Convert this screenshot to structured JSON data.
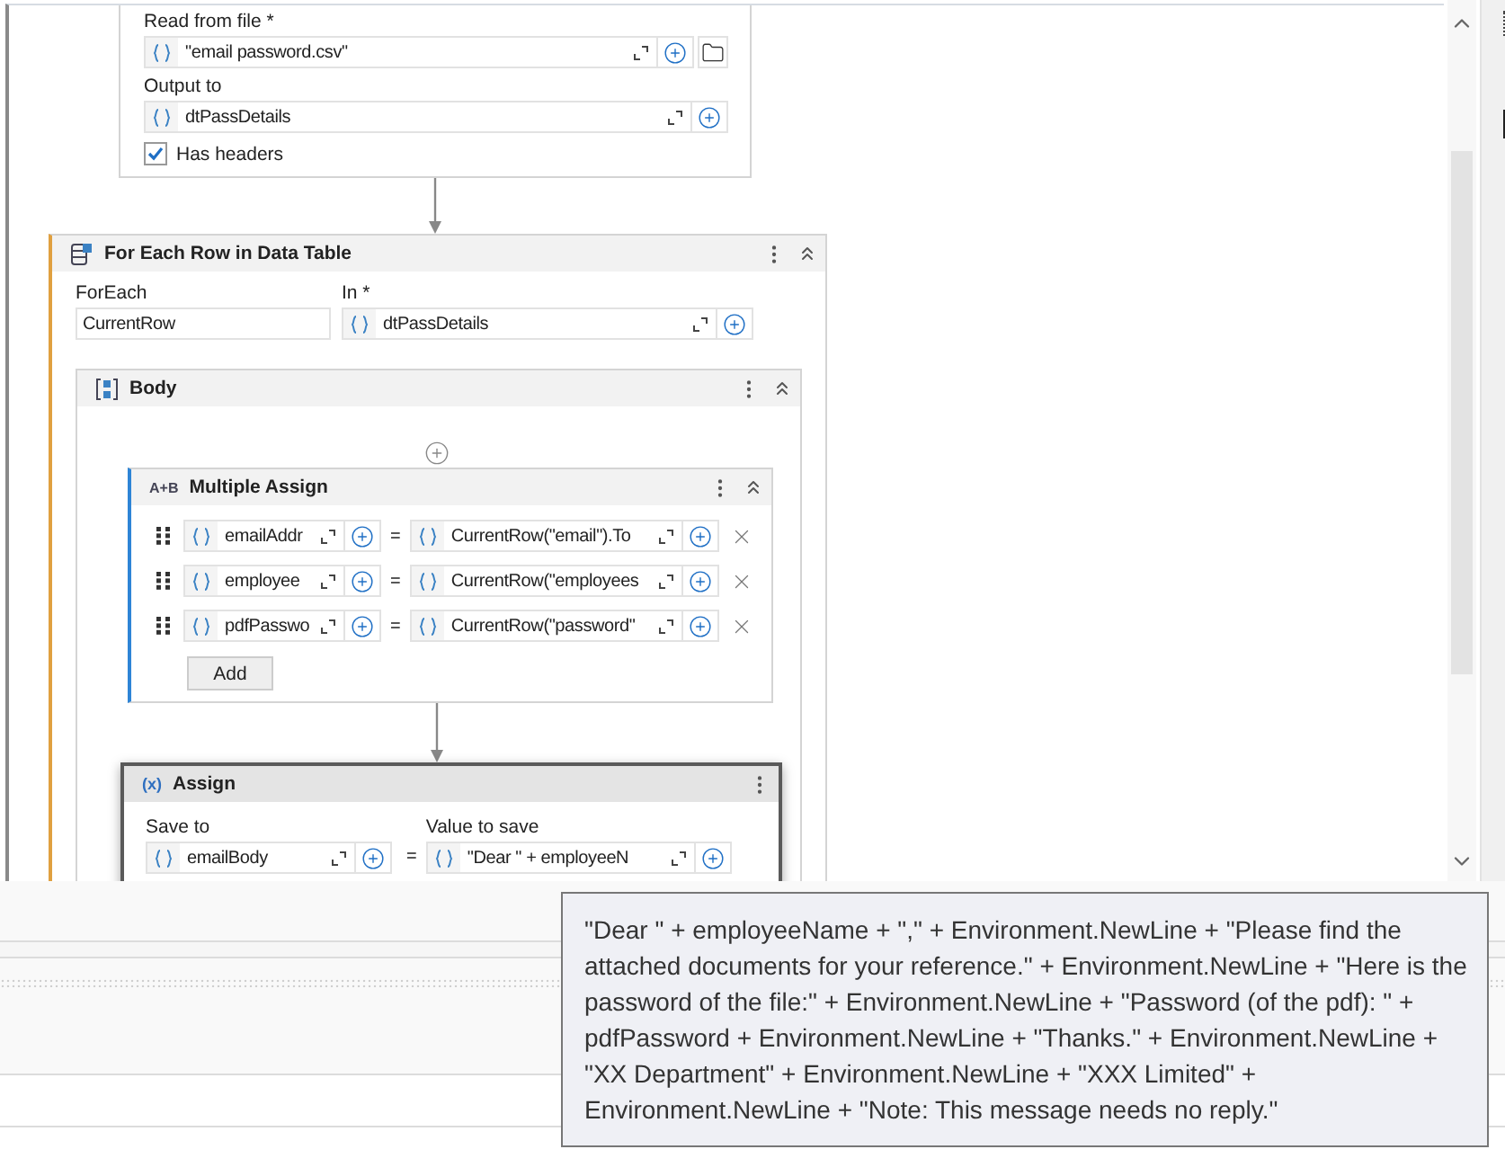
{
  "read_csv": {
    "fields": [
      {
        "label": "Read from file *",
        "value": "\"email password.csv\"",
        "browse": true
      },
      {
        "label": "Output to",
        "value": "dtPassDetails",
        "browse": false
      }
    ],
    "has_headers": {
      "label": "Has headers",
      "checked": true
    }
  },
  "for_each": {
    "title": "For Each Row in Data Table",
    "foreach_label": "ForEach",
    "foreach_value": "CurrentRow",
    "in_label": "In *",
    "in_value": "dtPassDetails",
    "body": {
      "title": "Body",
      "multiple_assign": {
        "icon_text": "A+B",
        "title": "Multiple Assign",
        "add_button": "Add",
        "rows": [
          {
            "target": "emailAddr",
            "equals": "=",
            "value": "CurrentRow(\"email\").To"
          },
          {
            "target": "employee",
            "equals": "=",
            "value": "CurrentRow(\"employees"
          },
          {
            "target": "pdfPasswo",
            "equals": "=",
            "value": "CurrentRow(\"password\""
          }
        ]
      },
      "assign": {
        "icon_text": "(x)",
        "title": "Assign",
        "save_to_label": "Save to",
        "save_to": "emailBody",
        "equals": "=",
        "value_label": "Value to save",
        "value": "\"Dear \" + employeeN"
      }
    }
  },
  "tooltip": "\"Dear \" + employeeName + \",\" + Environment.NewLine + \"Please find the attached documents for your reference.\" + Environment.NewLine + \"Here is the password of the file:\" + Environment.NewLine + \"Password (of the pdf): \" + pdfPassword + Environment.NewLine + \"Thanks.\" + Environment.NewLine + \"XX Department\" + Environment.NewLine + \"XXX Limited\" + Environment.NewLine + \"Note: This message needs no reply.\""
}
